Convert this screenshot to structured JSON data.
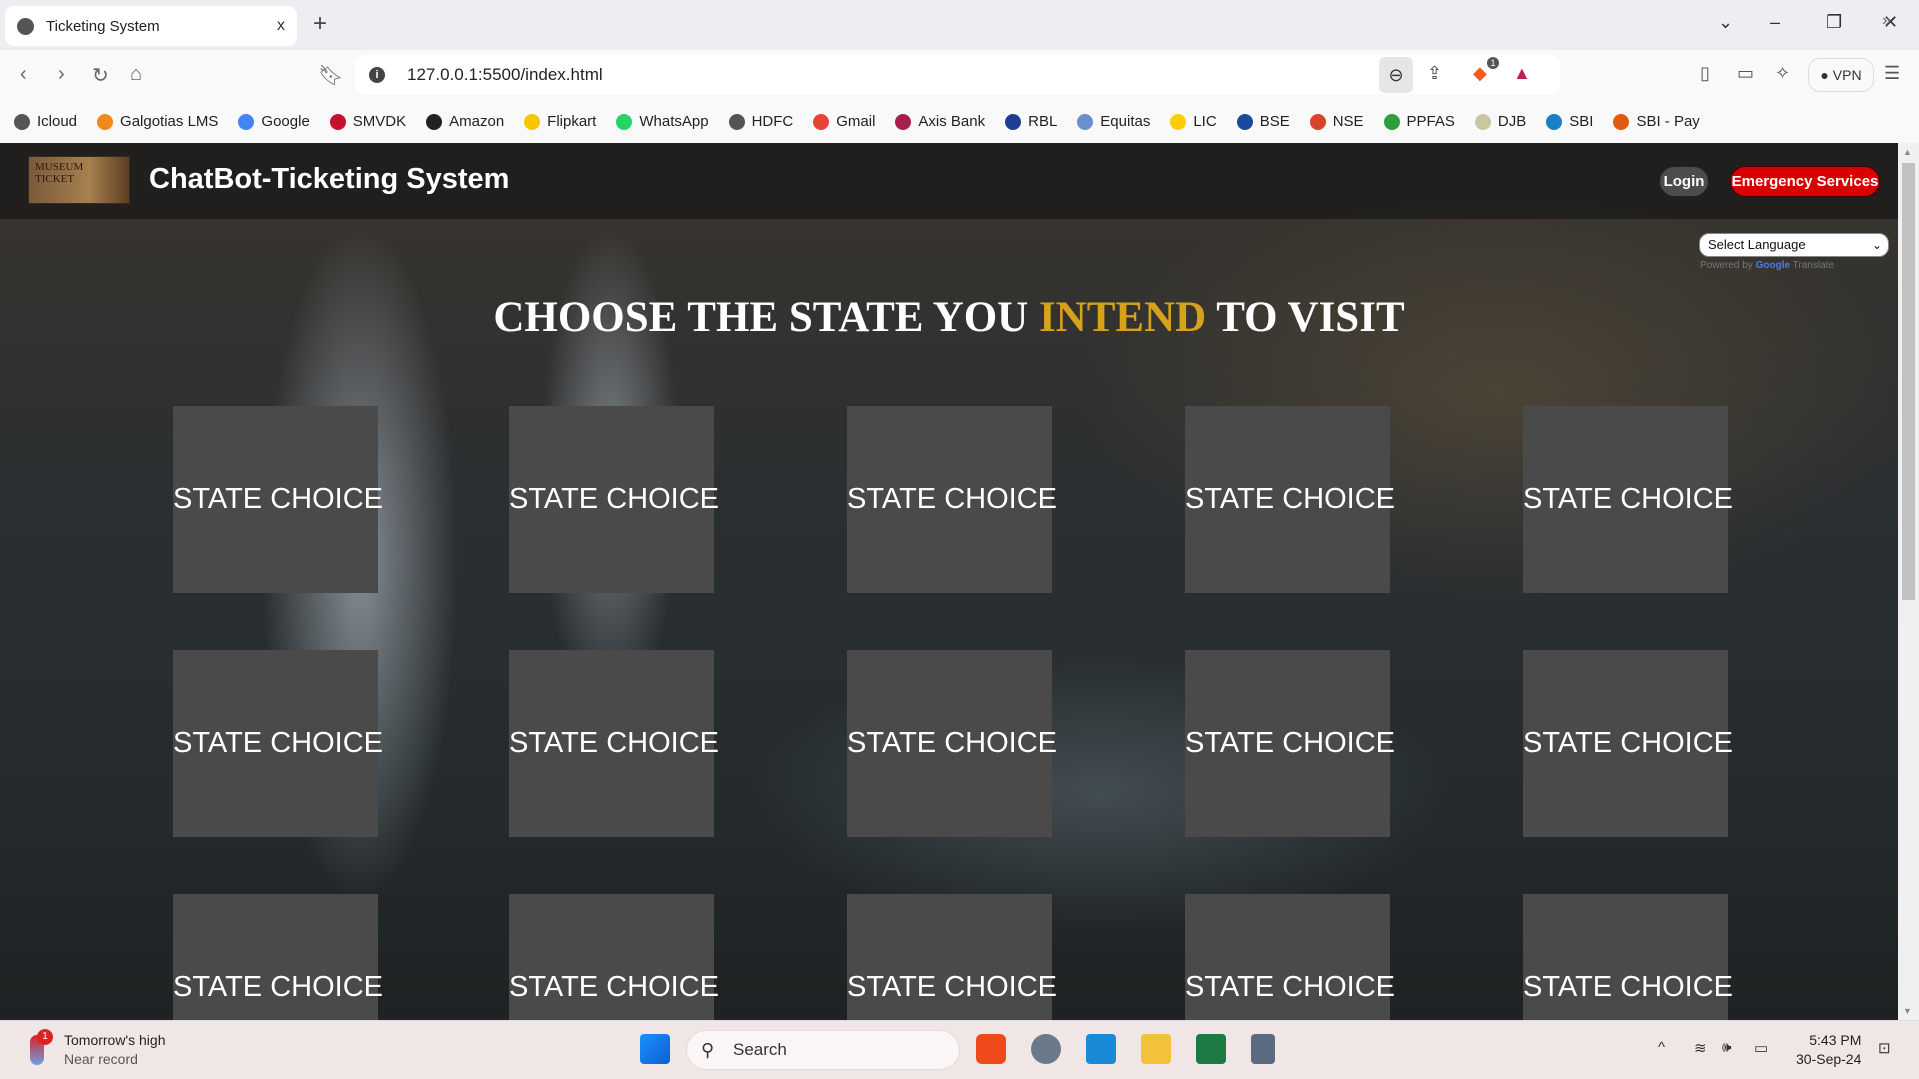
{
  "browser": {
    "tab_title": "Ticketing System",
    "tab_close": "x",
    "new_tab": "+",
    "url": "127.0.0.1:5500/index.html",
    "vpn_label": "VPN",
    "shields_badge": "1",
    "bookmarks": [
      "Icloud",
      "Galgotias LMS",
      "Google",
      "SMVDK",
      "Amazon",
      "Flipkart",
      "WhatsApp",
      "HDFC",
      "Gmail",
      "Axis Bank",
      "RBL",
      "Equitas",
      "LIC",
      "BSE",
      "NSE",
      "PPFAS",
      "DJB",
      "SBI",
      "SBI - Pay"
    ],
    "bookmark_colors": [
      "#555555",
      "#f08a1c",
      "#4285f4",
      "#c8102e",
      "#222222",
      "#f7c600",
      "#25d366",
      "#555555",
      "#ea4335",
      "#a5204a",
      "#1b3f94",
      "#6b8ecf",
      "#ffcc00",
      "#1a4a9a",
      "#d8442a",
      "#2e9e3e",
      "#c9c6a0",
      "#1a7ec8",
      "#e05a10"
    ],
    "more_bookmarks": "»"
  },
  "header": {
    "logo_text": "MUSEUM TICKET",
    "title": "ChatBot-Ticketing System",
    "login": "Login",
    "emergency": "Emergency Services"
  },
  "translate": {
    "select_label": "Select Language",
    "powered_by": "Powered by",
    "google": "Google",
    "translate": "Translate"
  },
  "main": {
    "heading_pre": "CHOOSE THE STATE YOU ",
    "heading_highlight": "INTEND",
    "heading_post": " TO VISIT",
    "cards": [
      "STATE CHOICE",
      "STATE CHOICE",
      "STATE CHOICE",
      "STATE CHOICE",
      "STATE CHOICE",
      "STATE CHOICE",
      "STATE CHOICE",
      "STATE CHOICE",
      "STATE CHOICE",
      "STATE CHOICE",
      "STATE CHOICE",
      "STATE CHOICE",
      "STATE CHOICE",
      "STATE CHOICE",
      "STATE CHOICE"
    ]
  },
  "taskbar": {
    "weather_title": "Tomorrow's high",
    "weather_sub": "Near record",
    "weather_badge": "1",
    "search": "Search",
    "time": "5:43 PM",
    "date": "30-Sep-24"
  }
}
